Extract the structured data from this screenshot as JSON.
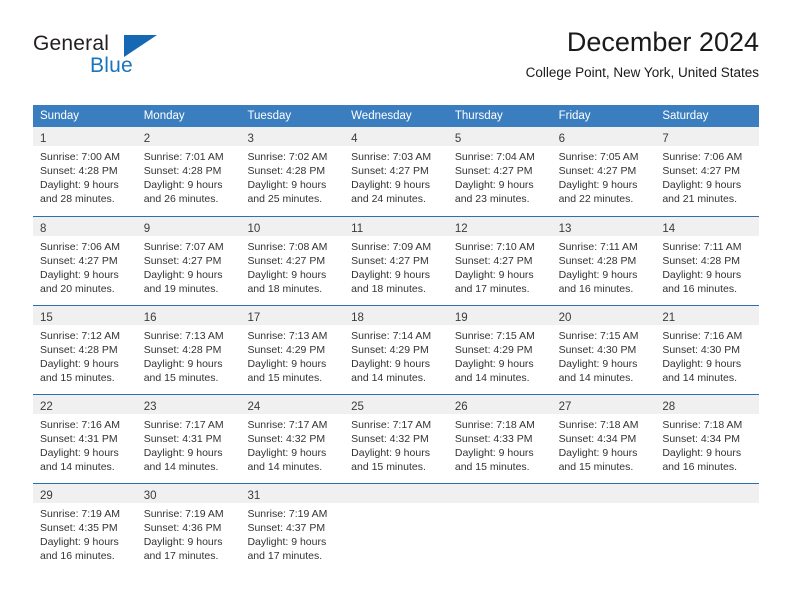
{
  "logo": {
    "word_one": "General",
    "word_two": "Blue",
    "triangle": "triangle-icon"
  },
  "header": {
    "title": "December 2024",
    "subtitle": "College Point, New York, United States"
  },
  "colors": {
    "header_blue": "#3b7ebf",
    "row_divider_blue": "#2e6fae",
    "day_band_gray": "#f0f0f0",
    "logo_blue": "#1b75bb",
    "text": "#333333"
  },
  "calendar": {
    "weekdays": [
      "Sunday",
      "Monday",
      "Tuesday",
      "Wednesday",
      "Thursday",
      "Friday",
      "Saturday"
    ],
    "weeks": [
      [
        {
          "day": "1",
          "lines": [
            "Sunrise: 7:00 AM",
            "Sunset: 4:28 PM",
            "Daylight: 9 hours",
            "and 28 minutes."
          ]
        },
        {
          "day": "2",
          "lines": [
            "Sunrise: 7:01 AM",
            "Sunset: 4:28 PM",
            "Daylight: 9 hours",
            "and 26 minutes."
          ]
        },
        {
          "day": "3",
          "lines": [
            "Sunrise: 7:02 AM",
            "Sunset: 4:28 PM",
            "Daylight: 9 hours",
            "and 25 minutes."
          ]
        },
        {
          "day": "4",
          "lines": [
            "Sunrise: 7:03 AM",
            "Sunset: 4:27 PM",
            "Daylight: 9 hours",
            "and 24 minutes."
          ]
        },
        {
          "day": "5",
          "lines": [
            "Sunrise: 7:04 AM",
            "Sunset: 4:27 PM",
            "Daylight: 9 hours",
            "and 23 minutes."
          ]
        },
        {
          "day": "6",
          "lines": [
            "Sunrise: 7:05 AM",
            "Sunset: 4:27 PM",
            "Daylight: 9 hours",
            "and 22 minutes."
          ]
        },
        {
          "day": "7",
          "lines": [
            "Sunrise: 7:06 AM",
            "Sunset: 4:27 PM",
            "Daylight: 9 hours",
            "and 21 minutes."
          ]
        }
      ],
      [
        {
          "day": "8",
          "lines": [
            "Sunrise: 7:06 AM",
            "Sunset: 4:27 PM",
            "Daylight: 9 hours",
            "and 20 minutes."
          ]
        },
        {
          "day": "9",
          "lines": [
            "Sunrise: 7:07 AM",
            "Sunset: 4:27 PM",
            "Daylight: 9 hours",
            "and 19 minutes."
          ]
        },
        {
          "day": "10",
          "lines": [
            "Sunrise: 7:08 AM",
            "Sunset: 4:27 PM",
            "Daylight: 9 hours",
            "and 18 minutes."
          ]
        },
        {
          "day": "11",
          "lines": [
            "Sunrise: 7:09 AM",
            "Sunset: 4:27 PM",
            "Daylight: 9 hours",
            "and 18 minutes."
          ]
        },
        {
          "day": "12",
          "lines": [
            "Sunrise: 7:10 AM",
            "Sunset: 4:27 PM",
            "Daylight: 9 hours",
            "and 17 minutes."
          ]
        },
        {
          "day": "13",
          "lines": [
            "Sunrise: 7:11 AM",
            "Sunset: 4:28 PM",
            "Daylight: 9 hours",
            "and 16 minutes."
          ]
        },
        {
          "day": "14",
          "lines": [
            "Sunrise: 7:11 AM",
            "Sunset: 4:28 PM",
            "Daylight: 9 hours",
            "and 16 minutes."
          ]
        }
      ],
      [
        {
          "day": "15",
          "lines": [
            "Sunrise: 7:12 AM",
            "Sunset: 4:28 PM",
            "Daylight: 9 hours",
            "and 15 minutes."
          ]
        },
        {
          "day": "16",
          "lines": [
            "Sunrise: 7:13 AM",
            "Sunset: 4:28 PM",
            "Daylight: 9 hours",
            "and 15 minutes."
          ]
        },
        {
          "day": "17",
          "lines": [
            "Sunrise: 7:13 AM",
            "Sunset: 4:29 PM",
            "Daylight: 9 hours",
            "and 15 minutes."
          ]
        },
        {
          "day": "18",
          "lines": [
            "Sunrise: 7:14 AM",
            "Sunset: 4:29 PM",
            "Daylight: 9 hours",
            "and 14 minutes."
          ]
        },
        {
          "day": "19",
          "lines": [
            "Sunrise: 7:15 AM",
            "Sunset: 4:29 PM",
            "Daylight: 9 hours",
            "and 14 minutes."
          ]
        },
        {
          "day": "20",
          "lines": [
            "Sunrise: 7:15 AM",
            "Sunset: 4:30 PM",
            "Daylight: 9 hours",
            "and 14 minutes."
          ]
        },
        {
          "day": "21",
          "lines": [
            "Sunrise: 7:16 AM",
            "Sunset: 4:30 PM",
            "Daylight: 9 hours",
            "and 14 minutes."
          ]
        }
      ],
      [
        {
          "day": "22",
          "lines": [
            "Sunrise: 7:16 AM",
            "Sunset: 4:31 PM",
            "Daylight: 9 hours",
            "and 14 minutes."
          ]
        },
        {
          "day": "23",
          "lines": [
            "Sunrise: 7:17 AM",
            "Sunset: 4:31 PM",
            "Daylight: 9 hours",
            "and 14 minutes."
          ]
        },
        {
          "day": "24",
          "lines": [
            "Sunrise: 7:17 AM",
            "Sunset: 4:32 PM",
            "Daylight: 9 hours",
            "and 14 minutes."
          ]
        },
        {
          "day": "25",
          "lines": [
            "Sunrise: 7:17 AM",
            "Sunset: 4:32 PM",
            "Daylight: 9 hours",
            "and 15 minutes."
          ]
        },
        {
          "day": "26",
          "lines": [
            "Sunrise: 7:18 AM",
            "Sunset: 4:33 PM",
            "Daylight: 9 hours",
            "and 15 minutes."
          ]
        },
        {
          "day": "27",
          "lines": [
            "Sunrise: 7:18 AM",
            "Sunset: 4:34 PM",
            "Daylight: 9 hours",
            "and 15 minutes."
          ]
        },
        {
          "day": "28",
          "lines": [
            "Sunrise: 7:18 AM",
            "Sunset: 4:34 PM",
            "Daylight: 9 hours",
            "and 16 minutes."
          ]
        }
      ],
      [
        {
          "day": "29",
          "lines": [
            "Sunrise: 7:19 AM",
            "Sunset: 4:35 PM",
            "Daylight: 9 hours",
            "and 16 minutes."
          ]
        },
        {
          "day": "30",
          "lines": [
            "Sunrise: 7:19 AM",
            "Sunset: 4:36 PM",
            "Daylight: 9 hours",
            "and 17 minutes."
          ]
        },
        {
          "day": "31",
          "lines": [
            "Sunrise: 7:19 AM",
            "Sunset: 4:37 PM",
            "Daylight: 9 hours",
            "and 17 minutes."
          ]
        },
        {
          "day": "",
          "lines": []
        },
        {
          "day": "",
          "lines": []
        },
        {
          "day": "",
          "lines": []
        },
        {
          "day": "",
          "lines": []
        }
      ]
    ]
  }
}
